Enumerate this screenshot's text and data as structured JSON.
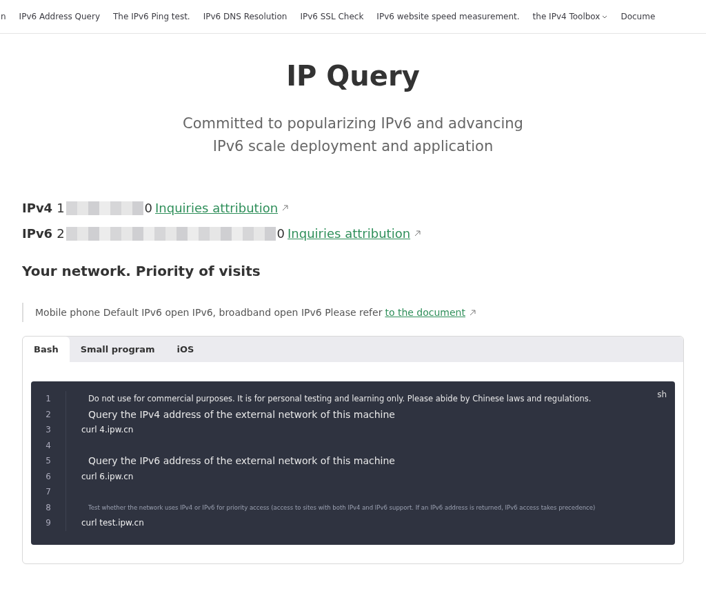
{
  "nav": [
    {
      "label": "n",
      "dropdown": false
    },
    {
      "label": "IPv6 Address Query",
      "dropdown": false
    },
    {
      "label": "The IPv6 Ping test.",
      "dropdown": false
    },
    {
      "label": "IPv6 DNS Resolution",
      "dropdown": false
    },
    {
      "label": "IPv6 SSL Check",
      "dropdown": false
    },
    {
      "label": "IPv6 website speed measurement.",
      "dropdown": false
    },
    {
      "label": "the IPv4 Toolbox",
      "dropdown": true
    },
    {
      "label": "Docume",
      "dropdown": false
    }
  ],
  "title": "IP Query",
  "subtitle": [
    "Committed to popularizing IPv6 and advancing",
    "IPv6 scale deployment and application"
  ],
  "addresses": [
    {
      "label": "IPv4",
      "value_start": "1",
      "value_end": "0",
      "link": "Inquiries attribution"
    },
    {
      "label": "IPv6",
      "value_start": "2",
      "value_end": "0",
      "link": "Inquiries attribution"
    }
  ],
  "section_heading": "Your network. Priority of visits",
  "note": {
    "text": "Mobile phone Default IPv6 open IPv6, broadband open IPv6 Please refer",
    "link": "to the document"
  },
  "tabs": [
    {
      "label": "Bash",
      "selected": true
    },
    {
      "label": "Small program",
      "selected": false
    },
    {
      "label": "iOS",
      "selected": false
    }
  ],
  "code": {
    "language": "sh",
    "lines": [
      {
        "number": "1",
        "kind": "notice",
        "text": "Do not use for commercial purposes. It is for personal testing and learning only. Please abide by Chinese laws and regulations."
      },
      {
        "number": "2",
        "kind": "comment",
        "text": "Query the IPv4 address of the external network of this machine"
      },
      {
        "number": "3",
        "kind": "command",
        "text": "curl 4.ipw.cn"
      },
      {
        "number": "4",
        "kind": "blank"
      },
      {
        "number": "5",
        "kind": "comment",
        "text": "Query the IPv6 address of the external network of this machine"
      },
      {
        "number": "6",
        "kind": "command",
        "text": "curl 6.ipw.cn"
      },
      {
        "number": "7",
        "kind": "blank"
      },
      {
        "number": "8",
        "kind": "fine",
        "text": "Test whether the network uses IPv4 or IPv6 for priority access (access to sites with both IPv4 and IPv6 support. If an IPv6 address is returned, IPv6 access takes precedence)"
      },
      {
        "number": "9",
        "kind": "command",
        "text": "curl test.ipw.cn"
      }
    ]
  }
}
